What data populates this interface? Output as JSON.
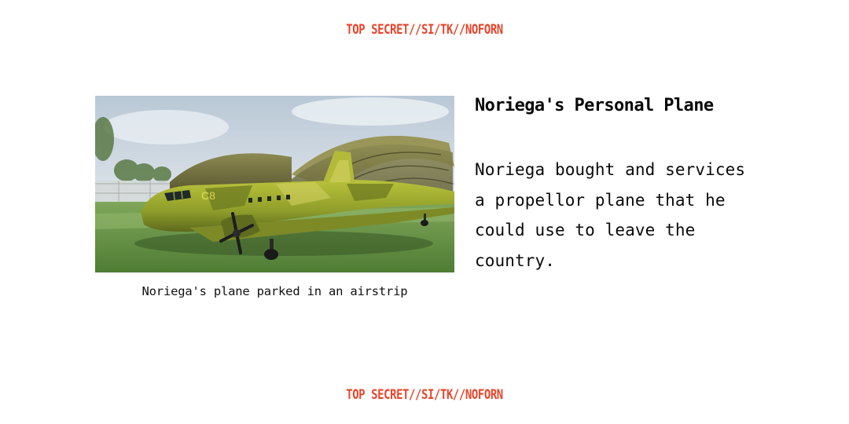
{
  "classification": {
    "top": "TOP SECRET//SI/TK//NOFORN",
    "bottom": "TOP SECRET//SI/TK//NOFORN"
  },
  "colors": {
    "classification": "#e8442a",
    "text": "#0a0a0a",
    "background": "#ffffff"
  },
  "figure": {
    "image_subject": "olive camouflage propeller plane parked in front of hangar",
    "tail_marking": "C8",
    "caption": "Noriega's plane parked in an airstrip"
  },
  "article": {
    "title": "Noriega's Personal Plane",
    "body": "Noriega bought and services a propellor plane that he could use to leave the country."
  }
}
